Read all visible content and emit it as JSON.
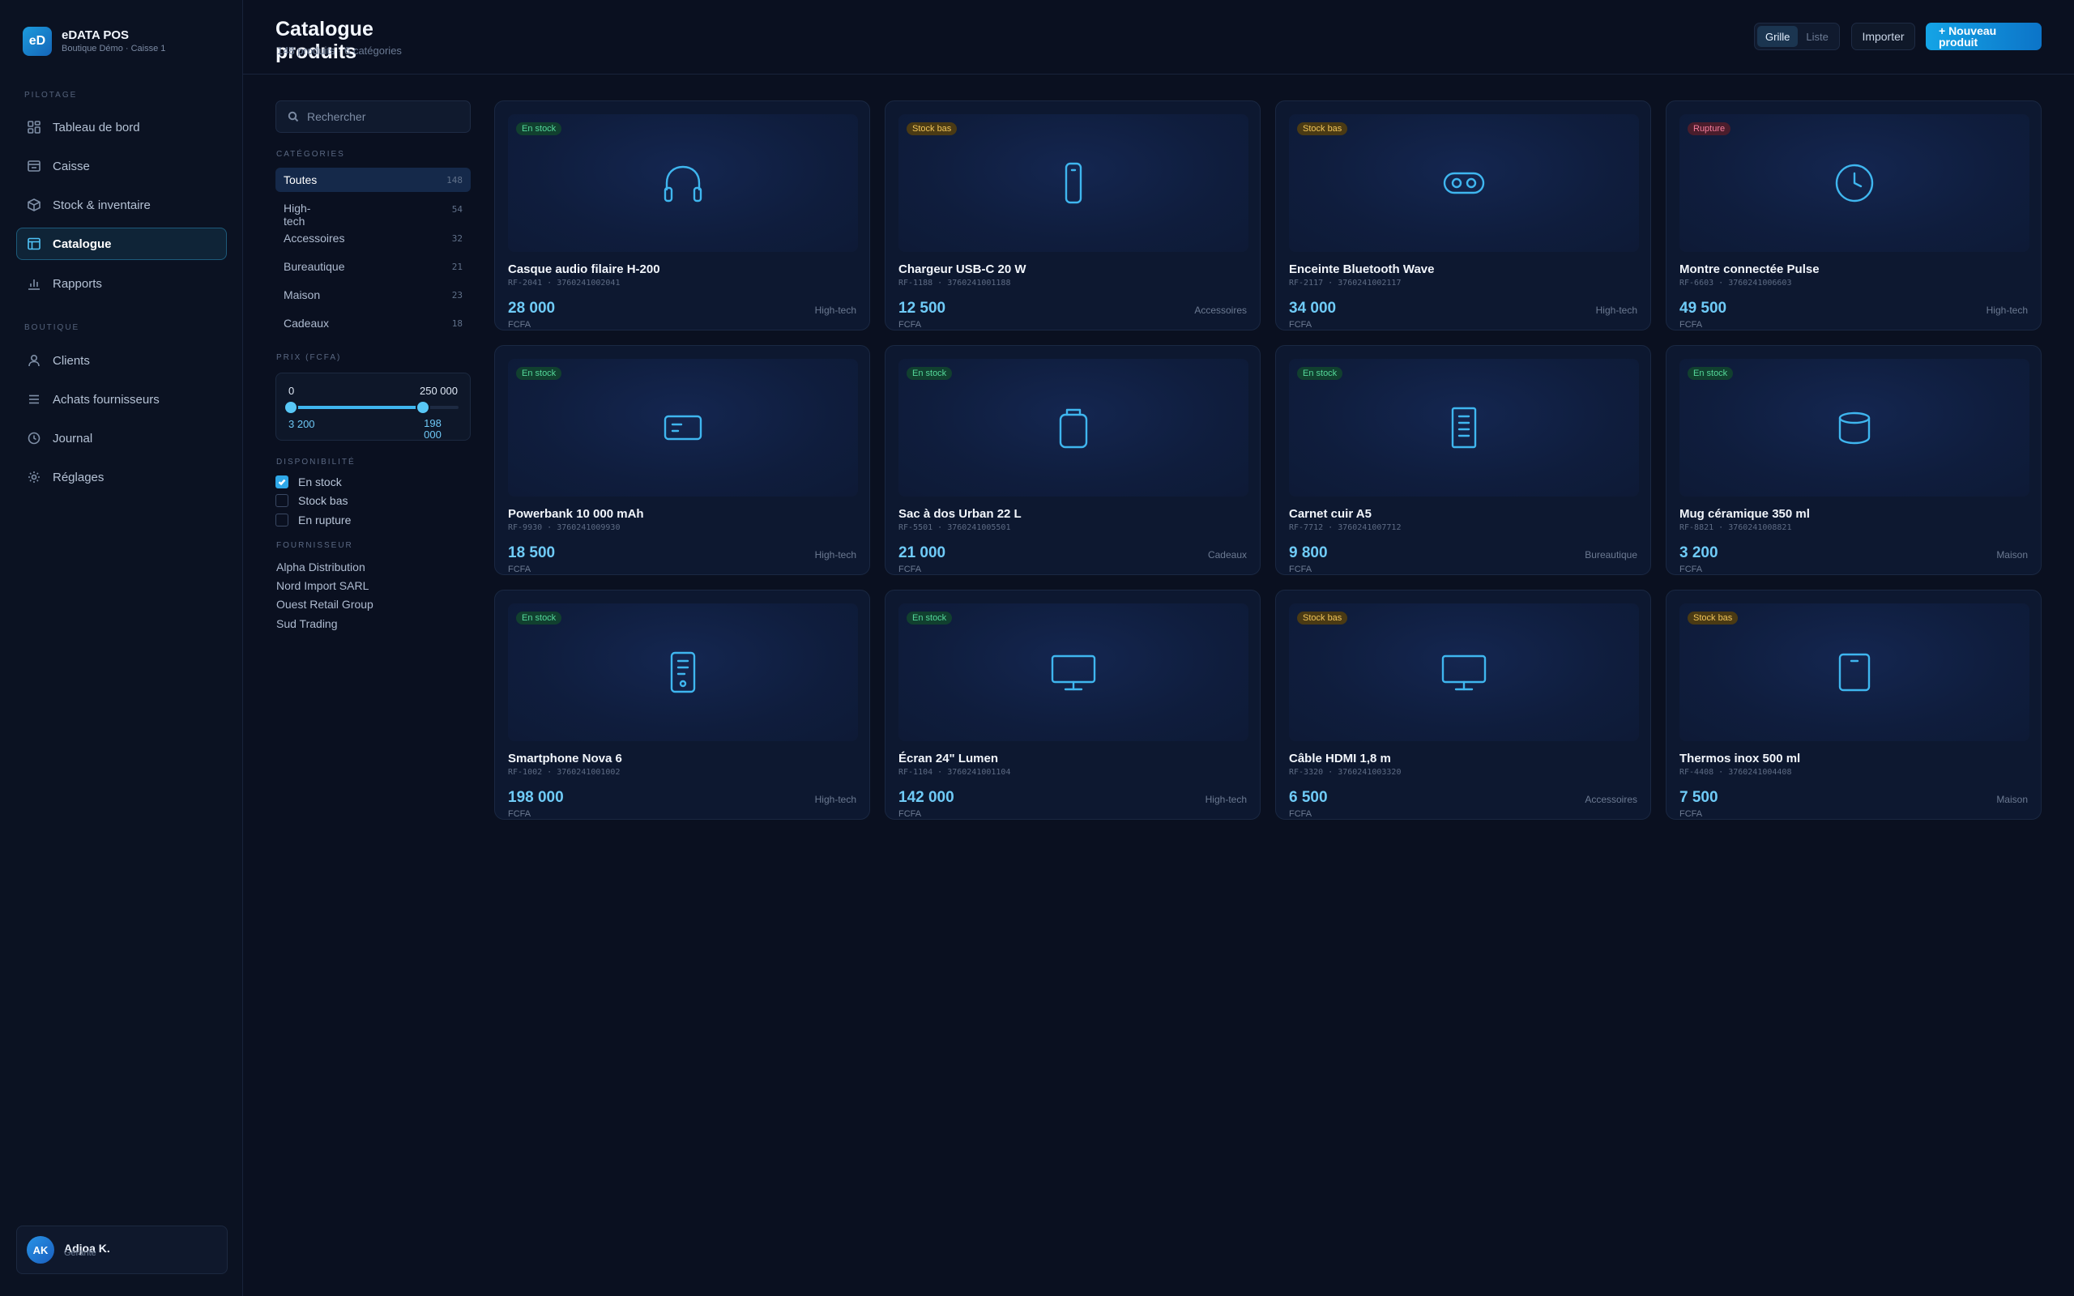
{
  "app": {
    "logo": "eD",
    "name": "eDATA POS",
    "subtitle": "Boutique Démo · Caisse 1"
  },
  "nav": {
    "section_pilotage": "PILOTAGE",
    "section_boutique": "BOUTIQUE",
    "items": [
      {
        "label": "Tableau de bord",
        "icon": "dashboard-icon"
      },
      {
        "label": "Caisse",
        "icon": "cash-register-icon"
      },
      {
        "label": "Stock & inventaire",
        "icon": "box-icon"
      },
      {
        "label": "Catalogue",
        "icon": "catalogue-icon",
        "active": true
      },
      {
        "label": "Rapports",
        "icon": "bar-chart-icon"
      },
      {
        "label": "Clients",
        "icon": "user-icon"
      },
      {
        "label": "Achats fournisseurs",
        "icon": "list-icon"
      },
      {
        "label": "Journal",
        "icon": "clock-icon"
      },
      {
        "label": "Réglages",
        "icon": "gear-icon"
      }
    ]
  },
  "user": {
    "initials": "AK",
    "name": "Adjoa K.",
    "role": "Gérante"
  },
  "header": {
    "title": "Catalogue produits",
    "subtitle": "148 produits · 6 catégories",
    "view_grid": "Grille",
    "view_list": "Liste",
    "import": "Importer",
    "new_product": "+ Nouveau produit"
  },
  "filters": {
    "search_placeholder": "Rechercher",
    "categories_label": "CATÉGORIES",
    "categories": [
      {
        "name": "Toutes",
        "count": "148",
        "active": true
      },
      {
        "name": "High-tech",
        "count": "54"
      },
      {
        "name": "Accessoires",
        "count": "32"
      },
      {
        "name": "Bureautique",
        "count": "21"
      },
      {
        "name": "Maison",
        "count": "23"
      },
      {
        "name": "Cadeaux",
        "count": "18"
      }
    ],
    "price_label": "PRIX (FCFA)",
    "price_min": "0",
    "price_max": "250 000",
    "price_low": "3 200",
    "price_high": "198 000",
    "price_low_fraction": 0.0128,
    "price_high_fraction": 0.792,
    "availability_label": "DISPONIBILITÉ",
    "availability": [
      {
        "label": "En stock",
        "checked": true
      },
      {
        "label": "Stock bas",
        "checked": false
      },
      {
        "label": "En rupture",
        "checked": false
      }
    ],
    "suppliers_label": "FOURNISSEUR",
    "suppliers": [
      "Alpha Distribution",
      "Nord Import SARL",
      "Ouest Retail Group",
      "Sud Trading"
    ]
  },
  "colors": {
    "accent": "#3fb6ef",
    "in_stock": "#54d79a",
    "low_stock": "#f0c458",
    "out_of_stock": "#f57d9c"
  },
  "products": [
    {
      "name": "Casque audio filaire H-200",
      "ref": "RF-2041 · 3760241002041",
      "price": "28 000",
      "currency": "FCFA",
      "category": "High-tech",
      "stock": "En stock",
      "status": "ok",
      "icon": "headphones-icon"
    },
    {
      "name": "Chargeur USB-C 20 W",
      "ref": "RF-1188 · 3760241001188",
      "price": "12 500",
      "currency": "FCFA",
      "category": "Accessoires",
      "stock": "Stock bas",
      "status": "low",
      "icon": "charger-icon"
    },
    {
      "name": "Enceinte Bluetooth Wave",
      "ref": "RF-2117 · 3760241002117",
      "price": "34 000",
      "currency": "FCFA",
      "category": "High-tech",
      "stock": "Stock bas",
      "status": "low",
      "icon": "speaker-icon"
    },
    {
      "name": "Montre connectée Pulse",
      "ref": "RF-6603 · 3760241006603",
      "price": "49 500",
      "currency": "FCFA",
      "category": "High-tech",
      "stock": "Rupture",
      "status": "out",
      "icon": "watch-icon"
    },
    {
      "name": "Powerbank 10 000 mAh",
      "ref": "RF-9930 · 3760241009930",
      "price": "18 500",
      "currency": "FCFA",
      "category": "High-tech",
      "stock": "En stock",
      "status": "ok",
      "icon": "powerbank-icon"
    },
    {
      "name": "Sac à dos Urban 22 L",
      "ref": "RF-5501 · 3760241005501",
      "price": "21 000",
      "currency": "FCFA",
      "category": "Cadeaux",
      "stock": "En stock",
      "status": "ok",
      "icon": "backpack-icon"
    },
    {
      "name": "Carnet cuir A5",
      "ref": "RF-7712 · 3760241007712",
      "price": "9 800",
      "currency": "FCFA",
      "category": "Bureautique",
      "stock": "En stock",
      "status": "ok",
      "icon": "notebook-icon"
    },
    {
      "name": "Mug céramique 350 ml",
      "ref": "RF-8821 · 3760241008821",
      "price": "3 200",
      "currency": "FCFA",
      "category": "Maison",
      "stock": "En stock",
      "status": "ok",
      "icon": "mug-icon"
    },
    {
      "name": "Smartphone Nova 6",
      "ref": "RF-1002 · 3760241001002",
      "price": "198 000",
      "currency": "FCFA",
      "category": "High-tech",
      "stock": "En stock",
      "status": "ok",
      "icon": "smartphone-icon"
    },
    {
      "name": "Écran 24\" Lumen",
      "ref": "RF-1104 · 3760241001104",
      "price": "142 000",
      "currency": "FCFA",
      "category": "High-tech",
      "stock": "En stock",
      "status": "ok",
      "icon": "monitor-icon"
    },
    {
      "name": "Câble HDMI 1,8 m",
      "ref": "RF-3320 · 3760241003320",
      "price": "6 500",
      "currency": "FCFA",
      "category": "Accessoires",
      "stock": "Stock bas",
      "status": "low",
      "icon": "cable-icon"
    },
    {
      "name": "Thermos inox 500 ml",
      "ref": "RF-4408 · 3760241004408",
      "price": "7 500",
      "currency": "FCFA",
      "category": "Maison",
      "stock": "Stock bas",
      "status": "low",
      "icon": "thermos-icon"
    }
  ]
}
